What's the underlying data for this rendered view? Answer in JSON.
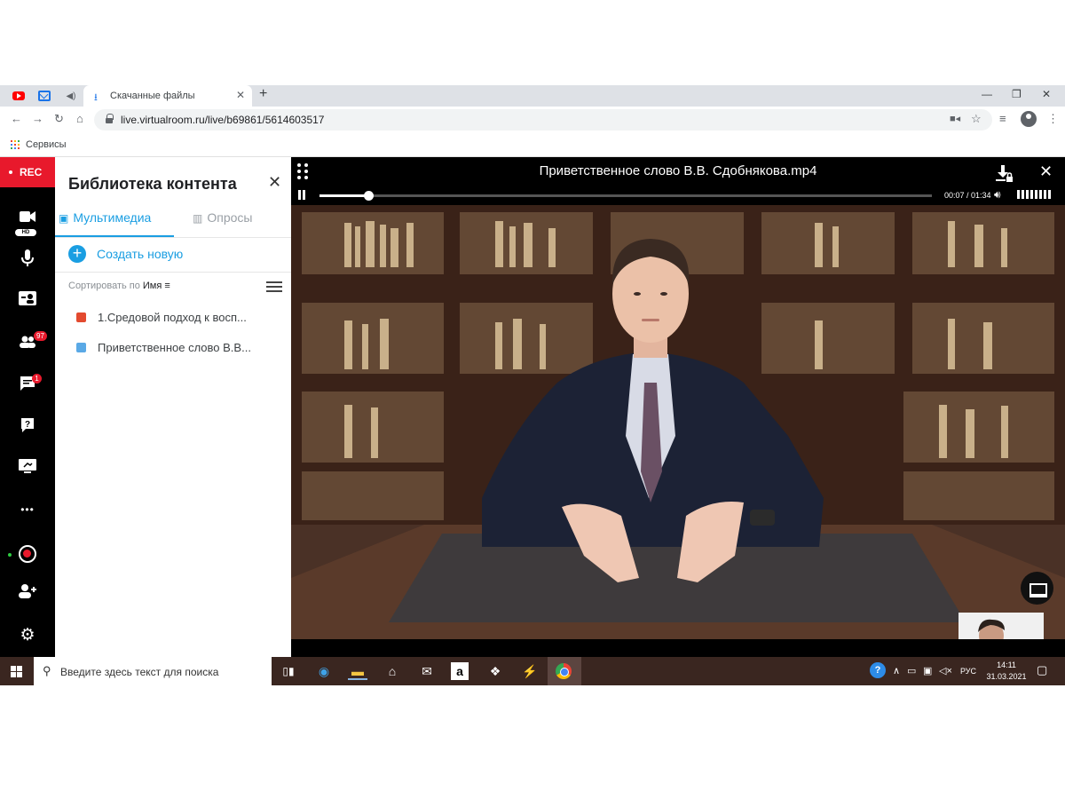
{
  "browser": {
    "tab_title": "Скачанные файлы",
    "url": "live.virtualroom.ru/live/b69861/5614603517",
    "bookmark": "Сервисы",
    "icons": [
      "youtube-icon",
      "mail-icon",
      "speaker-icon",
      "download-icon",
      "close-icon",
      "plus-icon",
      "back-icon",
      "forward-icon",
      "reload-icon",
      "home-icon",
      "lock-icon",
      "camera-icon",
      "star-icon",
      "reading-list-icon",
      "profile-icon",
      "menu-icon"
    ]
  },
  "rail": {
    "rec_label": "REC",
    "hd_label": "HD",
    "participants_badge": "97",
    "chat_badge": "1",
    "more_label": "•••",
    "colors": {
      "rail": "#000000",
      "rec": "#e8192c",
      "accent": "#1a9ee2"
    }
  },
  "library": {
    "title": "Библиотека контента",
    "tabs": [
      {
        "label": "Мультимедиа",
        "active": true
      },
      {
        "label": "Опросы",
        "active": false
      }
    ],
    "create_label": "Создать новую",
    "sort_prefix": "Сортировать по",
    "sort_by": "Имя",
    "files": [
      {
        "name": "1.Средовой подход к восп...",
        "icon": "presentation-icon",
        "color": "#e34a2f"
      },
      {
        "name": "Приветственное слово В.В...",
        "icon": "video-file-icon",
        "color": "#5aa9e6"
      }
    ]
  },
  "player": {
    "title": "Приветственное слово В.В. Сдобнякова.mp4",
    "time": "00:07 / 01:34",
    "progress": 0.08
  },
  "taskbar": {
    "search_placeholder": "Введите здесь текст для поиска",
    "language": "РУС",
    "time": "14:11",
    "date": "31.03.2021"
  }
}
